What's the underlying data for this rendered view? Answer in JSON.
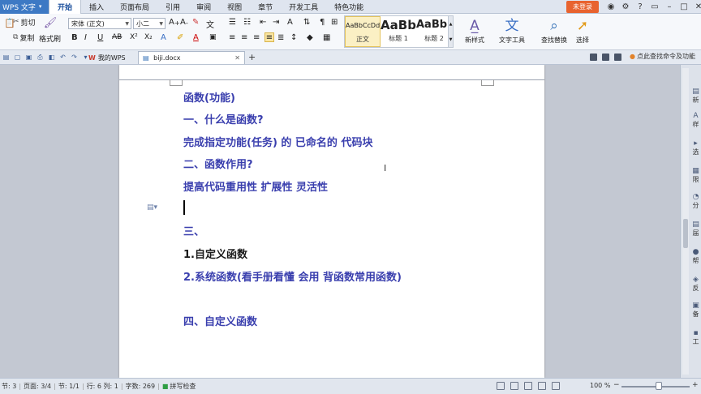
{
  "menubar": {
    "app_name": "WPS 文字",
    "items": [
      "开始",
      "插入",
      "页面布局",
      "引用",
      "审阅",
      "视图",
      "章节",
      "开发工具",
      "特色功能"
    ],
    "active": "开始",
    "login": "未登录"
  },
  "ribbon": {
    "paste_label": "粘贴",
    "cut_label": "剪切",
    "copy_label": "复制",
    "format_painter_label": "格式刷",
    "font_name": "宋体 (正文)",
    "font_size": "小二",
    "styles": [
      {
        "preview": "AaBbCcDd",
        "name": "正文"
      },
      {
        "preview": "AaBb",
        "name": "标题 1"
      },
      {
        "preview": "AaBb(",
        "name": "标题 2"
      }
    ],
    "new_style_label": "新样式",
    "text_tools_label": "文字工具",
    "find_replace_label": "查找替换",
    "select_label": "选择"
  },
  "tabs": {
    "wps_tab": "我的WPS",
    "doc_tab": "biji.docx",
    "cmd_search": "点此查找命令及功能"
  },
  "document": {
    "lines": [
      "函数(功能)",
      "一、什么是函数?",
      "完成指定功能(任务) 的 已命名的   代码块",
      "二、函数作用?",
      "提高代码重用性  扩展性  灵活性",
      "三、",
      "1.自定义函数",
      "2.系统函数(看手册看懂  会用  背函数常用函数)",
      "四、自定义函数"
    ]
  },
  "taskpane": {
    "items": [
      "新",
      "样",
      "选",
      "限",
      "分",
      "届",
      "帮",
      "反",
      "备",
      "工"
    ]
  },
  "status": {
    "section": "节: 3",
    "page": "页面: 3/4",
    "pos": "节: 1/1",
    "line_col": "行: 6  列: 1",
    "word_count": "字数: 269",
    "spell": "拼写检查",
    "zoom": "100 %"
  },
  "colors": {
    "heading_blue": "#3a3fae",
    "app_blue": "#3d79c4",
    "login_orange": "#e8632f"
  }
}
